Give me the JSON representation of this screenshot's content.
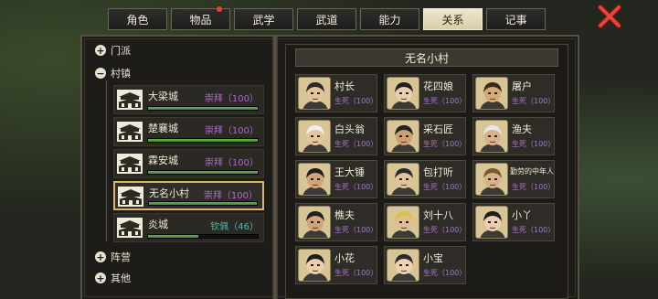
{
  "tabs": [
    {
      "label": "角色",
      "active": false,
      "badge": false
    },
    {
      "label": "物品",
      "active": false,
      "badge": true
    },
    {
      "label": "武学",
      "active": false,
      "badge": false
    },
    {
      "label": "武道",
      "active": false,
      "badge": false
    },
    {
      "label": "能力",
      "active": false,
      "badge": false
    },
    {
      "label": "关系",
      "active": true,
      "badge": false
    },
    {
      "label": "记事",
      "active": false,
      "badge": false
    }
  ],
  "groups": {
    "sect": "门派",
    "town": "村镇",
    "camp": "阵营",
    "other": "其他"
  },
  "towns": [
    {
      "name": "大梁城",
      "relation": "崇拜（100）",
      "progress": 1.0,
      "color": "purple",
      "selected": false
    },
    {
      "name": "楚襄城",
      "relation": "崇拜（100）",
      "progress": 1.0,
      "color": "purple",
      "selected": false
    },
    {
      "name": "霖安城",
      "relation": "崇拜（100）",
      "progress": 1.0,
      "color": "purple",
      "selected": false
    },
    {
      "name": "无名小村",
      "relation": "崇拜（100）",
      "progress": 1.0,
      "color": "purple",
      "selected": true
    },
    {
      "name": "炎城",
      "relation": "钦佩（46）",
      "progress": 0.46,
      "color": "green",
      "selected": false
    }
  ],
  "village_title": "无名小村",
  "npcs": [
    {
      "name": "村长",
      "relation": "生死（100）",
      "skin": "#e3c59a",
      "hair": "#2a2a2a"
    },
    {
      "name": "花四娘",
      "relation": "生死（100）",
      "skin": "#e9cfae",
      "hair": "#1f1f1f"
    },
    {
      "name": "屠户",
      "relation": "生死（100）",
      "skin": "#d7a979",
      "hair": "#3b2a20"
    },
    {
      "name": "白头翁",
      "relation": "生死（100）",
      "skin": "#e4c6a0",
      "hair": "#eeeeee"
    },
    {
      "name": "采石匠",
      "relation": "生死（100）",
      "skin": "#cf9f73",
      "hair": "#222222"
    },
    {
      "name": "渔夫",
      "relation": "生死（100）",
      "skin": "#d9b28a",
      "hair": "#e6e6e6"
    },
    {
      "name": "王大锤",
      "relation": "生死（100）",
      "skin": "#d3a478",
      "hair": "#1f1f1f"
    },
    {
      "name": "包打听",
      "relation": "生死（100）",
      "skin": "#e2c39c",
      "hair": "#2b2b2b"
    },
    {
      "name": "勤劳的中年人",
      "relation": "生死（100）",
      "skin": "#d9b28a",
      "hair": "#7a5a2f"
    },
    {
      "name": "樵夫",
      "relation": "生死（100）",
      "skin": "#d3a478",
      "hair": "#202020"
    },
    {
      "name": "刘十八",
      "relation": "生死（100）",
      "skin": "#e0bf95",
      "hair": "#d9c24a"
    },
    {
      "name": "小丫",
      "relation": "生死（100）",
      "skin": "#ebcfae",
      "hair": "#1e1e1e"
    },
    {
      "name": "小花",
      "relation": "生死（100）",
      "skin": "#ebcfae",
      "hair": "#1e1e1e"
    },
    {
      "name": "小宝",
      "relation": "生死（100）",
      "skin": "#f0d3b0",
      "hair": "#2a2a2a"
    }
  ]
}
